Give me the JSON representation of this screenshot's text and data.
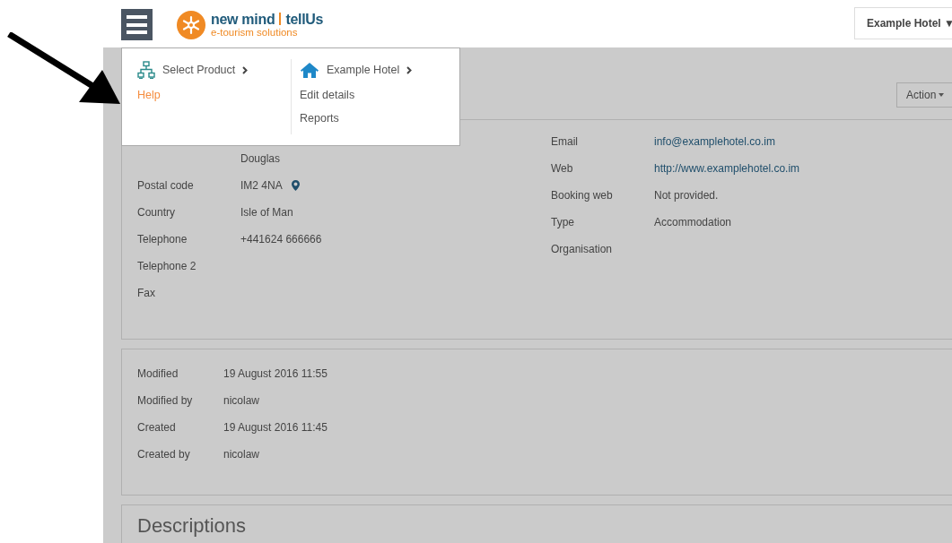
{
  "header": {
    "logo": {
      "name": "new mind",
      "brand": "tellUs",
      "tagline": "e-tourism solutions"
    },
    "hotel_menu": {
      "label": "Example Hotel",
      "caret": "▼"
    }
  },
  "menu": {
    "columns": [
      {
        "heading": "Select Product",
        "items": [
          {
            "label": "Help",
            "selected": true
          }
        ]
      },
      {
        "heading": "Example Hotel",
        "items": [
          {
            "label": "Edit details",
            "selected": false
          },
          {
            "label": "Reports",
            "selected": false
          }
        ]
      }
    ]
  },
  "action_button": "Action",
  "details": {
    "address_tail": "Douglas",
    "left": [
      {
        "label": "Postal code",
        "value": "IM2 4NA",
        "map_pin": true
      },
      {
        "label": "Country",
        "value": "Isle of Man",
        "map_pin": false
      },
      {
        "label": "Telephone",
        "value": "+441624 666666",
        "map_pin": false
      },
      {
        "label": "Telephone 2",
        "map_pin": false
      },
      {
        "label": "Fax",
        "map_pin": false
      }
    ],
    "right": [
      {
        "label": "Email",
        "value": "info@examplehotel.co.im",
        "kind": "link"
      },
      {
        "label": "Web",
        "value": "http://www.examplehotel.co.im",
        "kind": "link"
      },
      {
        "label": "Booking web",
        "value": "Not provided.",
        "kind": "text"
      },
      {
        "label": "Type",
        "value": "Accommodation",
        "kind": "text"
      },
      {
        "label": "Organisation"
      }
    ]
  },
  "record": [
    {
      "label": "Modified",
      "value": "19 August 2016 11:55"
    },
    {
      "label": "Modified by",
      "value": "nicolaw"
    },
    {
      "label": "Created",
      "value": "19 August 2016 11:45"
    },
    {
      "label": "Created by",
      "value": "nicolaw"
    }
  ],
  "descriptions": {
    "title": "Descriptions"
  }
}
